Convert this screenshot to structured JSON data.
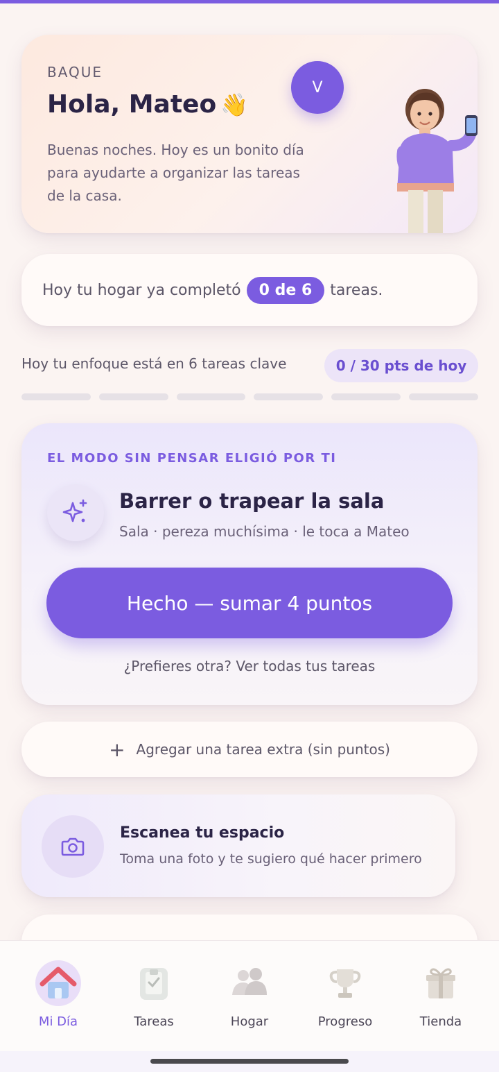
{
  "theme": {
    "accent": "#7b5ce0",
    "background": "#fbf4f2"
  },
  "greeting": {
    "brand": "BAQUE",
    "hello": "Hola, Mateo",
    "wave": "👋",
    "message": "Buenas noches. Hoy es un bonito día para ayudarte a organizar las tareas de la casa.",
    "avatar_initial": "V"
  },
  "progress": {
    "prefix": "Hoy tu hogar ya completó",
    "count": "0 de 6",
    "suffix": "tareas.",
    "completed": 0,
    "total": 6
  },
  "focus": {
    "text": "Hoy tu enfoque está en 6 tareas clave",
    "points": "0 / 30 pts de hoy",
    "segments_filled": 0,
    "segments_total": 6
  },
  "suggested_task": {
    "kicker": "EL MODO SIN PENSAR ELIGIÓ POR TI",
    "icon": "sparkles-icon",
    "title": "Barrer o trapear la sala",
    "subtitle": "Sala · pereza muchísima · le toca a Mateo",
    "done_label": "Hecho — sumar 4 puntos",
    "other_link": "¿Prefieres otra? Ver todas tus tareas"
  },
  "extra_task": {
    "plus": "+",
    "label": "Agregar una tarea extra (sin puntos)"
  },
  "scan": {
    "icon": "camera-icon",
    "title": "Escanea tu espacio",
    "subtitle": "Toma una foto y te sugiero qué hacer primero"
  },
  "nav": {
    "active": "Mi Día",
    "items": [
      {
        "label": "Mi Día",
        "icon": "house-icon"
      },
      {
        "label": "Tareas",
        "icon": "clipboard-icon"
      },
      {
        "label": "Hogar",
        "icon": "people-icon"
      },
      {
        "label": "Progreso",
        "icon": "trophy-icon"
      },
      {
        "label": "Tienda",
        "icon": "gift-icon"
      }
    ]
  }
}
